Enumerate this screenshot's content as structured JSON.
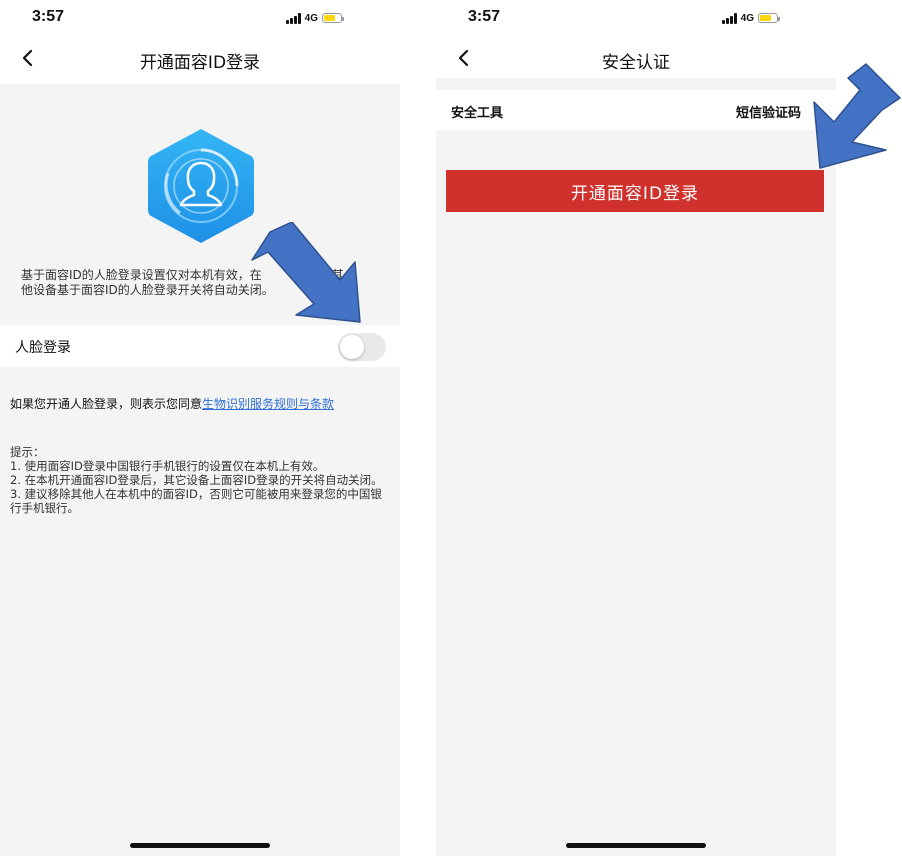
{
  "left": {
    "status": {
      "time": "3:57",
      "network": "4G"
    },
    "nav": {
      "title": "开通面容ID登录"
    },
    "info_lines": [
      "基于面容ID的人脸登录设置仅对本机有效，在",
      "他设备基于面容ID的人脸登录开关将自动关闭。"
    ],
    "info_tail": "其",
    "face_login": {
      "label": "人脸登录",
      "enabled": false
    },
    "agreement": {
      "prefix": "如果您开通人脸登录，则表示您同意",
      "link": "生物识别服务规则与条款"
    },
    "tips": [
      "提示：",
      "1. 使用面容ID登录中国银行手机银行的设置仅在本机上有效。",
      "  2. 在本机开通面容ID登录后，其它设备上面容ID登录的开关将自动关闭。",
      "  3. 建议移除其他人在本机中的面容ID，否则它可能被用来登录您的中国银行手机银行。"
    ]
  },
  "right": {
    "status": {
      "time": "3:57",
      "network": "4G"
    },
    "nav": {
      "title": "安全认证"
    },
    "security_tool": {
      "label": "安全工具",
      "value": "短信验证码"
    },
    "open_button": "开通面容ID登录"
  },
  "colors": {
    "primary_red": "#d0312d",
    "link_blue": "#2f6fd6",
    "shield_blue": "#2ea9f0",
    "arrow_blue": "#4472c4",
    "battery_yellow": "#ffd60a"
  },
  "icons": [
    "back-chevron-icon",
    "face-id-shield-icon",
    "signal-icon",
    "battery-icon",
    "annotation-arrow-icon"
  ]
}
